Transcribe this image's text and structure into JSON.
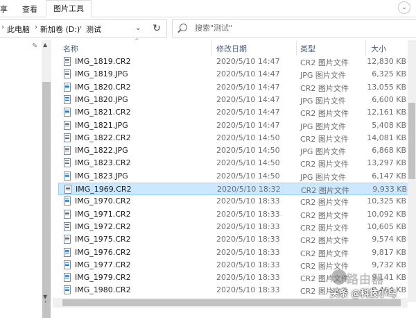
{
  "ribbon": {
    "tabs": [
      "享",
      "查看",
      "图片工具"
    ],
    "active_tab_index": 2
  },
  "address": {
    "crumbs": [
      "此电脑",
      "新加卷 (D:)",
      "测试"
    ]
  },
  "search": {
    "placeholder": "搜索\"测试\""
  },
  "columns": {
    "name": "名称",
    "date": "修改日期",
    "type": "类型",
    "size": "大小"
  },
  "files": [
    {
      "name": "IMG_1819.CR2",
      "date": "2020/5/10 14:47",
      "type": "CR2 图片文件",
      "size": "12,830 KB"
    },
    {
      "name": "IMG_1819.JPG",
      "date": "2020/5/10 14:47",
      "type": "JPG 图片文件",
      "size": "6,325 KB"
    },
    {
      "name": "IMG_1820.CR2",
      "date": "2020/5/10 14:47",
      "type": "CR2 图片文件",
      "size": "13,055 KB"
    },
    {
      "name": "IMG_1820.JPG",
      "date": "2020/5/10 14:47",
      "type": "JPG 图片文件",
      "size": "6,600 KB"
    },
    {
      "name": "IMG_1821.CR2",
      "date": "2020/5/10 14:47",
      "type": "CR2 图片文件",
      "size": "12,161 KB"
    },
    {
      "name": "IMG_1821.JPG",
      "date": "2020/5/10 14:47",
      "type": "JPG 图片文件",
      "size": "5,408 KB"
    },
    {
      "name": "IMG_1822.CR2",
      "date": "2020/5/10 14:50",
      "type": "CR2 图片文件",
      "size": "14,081 KB"
    },
    {
      "name": "IMG_1822.JPG",
      "date": "2020/5/10 14:50",
      "type": "JPG 图片文件",
      "size": "6,868 KB"
    },
    {
      "name": "IMG_1823.CR2",
      "date": "2020/5/10 14:50",
      "type": "CR2 图片文件",
      "size": "13,297 KB"
    },
    {
      "name": "IMG_1823.JPG",
      "date": "2020/5/10 14:50",
      "type": "JPG 图片文件",
      "size": "6,147 KB"
    },
    {
      "name": "IMG_1969.CR2",
      "date": "2020/5/10 18:32",
      "type": "CR2 图片文件",
      "size": "9,933 KB",
      "selected": true
    },
    {
      "name": "IMG_1970.CR2",
      "date": "2020/5/10 18:33",
      "type": "CR2 图片文件",
      "size": "10,325 KB"
    },
    {
      "name": "IMG_1971.CR2",
      "date": "2020/5/10 18:33",
      "type": "CR2 图片文件",
      "size": "10,092 KB"
    },
    {
      "name": "IMG_1972.CR2",
      "date": "2020/5/10 18:33",
      "type": "CR2 图片文件",
      "size": "10,605 KB"
    },
    {
      "name": "IMG_1975.CR2",
      "date": "2020/5/10 18:33",
      "type": "CR2 图片文件",
      "size": "9,574 KB"
    },
    {
      "name": "IMG_1976.CR2",
      "date": "2020/5/10 18:33",
      "type": "CR2 图片文件",
      "size": "9,817 KB"
    },
    {
      "name": "IMG_1977.CR2",
      "date": "2020/5/10 18:33",
      "type": "CR2 图片文件",
      "size": "9,732 KB"
    },
    {
      "name": "IMG_1979.CR2",
      "date": "2020/5/10 18:33",
      "type": "CR2 图片文件",
      "size": "9,141 KB"
    },
    {
      "name": "IMG_1980.CR2",
      "date": "2020/5/10 18:33",
      "type": "CR2 图片文件",
      "size": "9,464 KB"
    }
  ],
  "watermark": {
    "text": "头条 @科技小鸟",
    "logo_text": "路由器"
  }
}
